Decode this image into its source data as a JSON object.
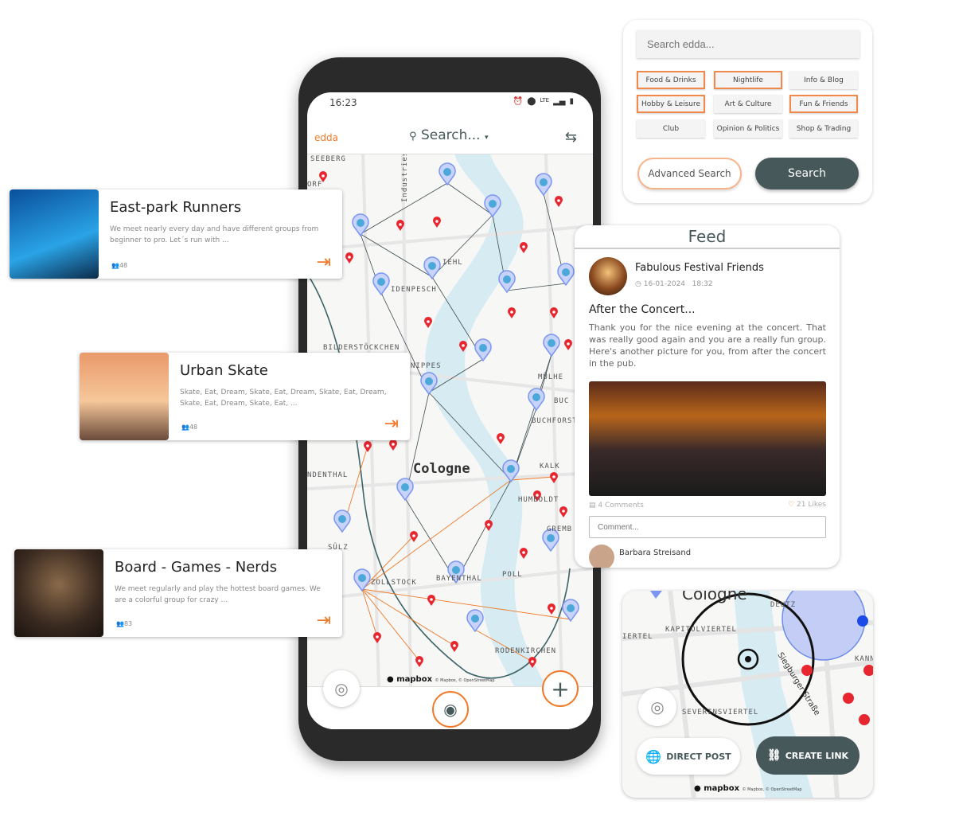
{
  "phone": {
    "status_time": "16:23",
    "status_network": "LTE",
    "app_logo": "edda",
    "header_search": "Search...",
    "map_labels": [
      "SEEBERG",
      "ORF",
      "Industriestraße",
      "IEHL",
      "IDENPESCH",
      "BILDERSTÖCKCHEN",
      "NIPPES",
      "MÜLHE",
      "BUC",
      "BUCHFORST",
      "Cologne",
      "KALK",
      "NDENTHAL",
      "HUMBOLDT",
      "GREMB",
      "SÜLZ",
      "ZOLLSTOCK",
      "BAYENTHAL",
      "POLL",
      "RODENKIRCHEN"
    ],
    "mapbox": "mapbox",
    "attribution": "© Mapbox, © OpenStreetMap",
    "icons": [
      "search-icon",
      "swap-icon",
      "locate-icon",
      "nearby-pin-icon",
      "plus-icon"
    ]
  },
  "groups": [
    {
      "title": "East-park Runners",
      "description": "We meet nearly every day and have different groups from beginner to pro. Let´s run with ...",
      "members": "48"
    },
    {
      "title": "Urban Skate",
      "description": "Skate, Eat, Dream, Skate, Eat, Dream, Skate, Eat, Dream, Skate, Eat, Dream, Skate, Eat, ...",
      "members": "48"
    },
    {
      "title": "Board - Games - Nerds",
      "description": "We meet regularly and play the hottest board games. We are a colorful group for crazy ...",
      "members": "83"
    }
  ],
  "search_panel": {
    "placeholder": "Search edda...",
    "categories": [
      {
        "label": "Food & Drinks",
        "selected": true
      },
      {
        "label": "Nightlife",
        "selected": true
      },
      {
        "label": "Info & Blog",
        "selected": false
      },
      {
        "label": "Hobby & Leisure",
        "selected": true
      },
      {
        "label": "Art & Culture",
        "selected": false
      },
      {
        "label": "Fun & Friends",
        "selected": true
      },
      {
        "label": "Club",
        "selected": false
      },
      {
        "label": "Opinion & Politics",
        "selected": false
      },
      {
        "label": "Shop & Trading",
        "selected": false
      }
    ],
    "advanced_label": "Advanced Search",
    "search_label": "Search"
  },
  "feed": {
    "title": "Feed",
    "post": {
      "group": "Fabulous Festival Friends",
      "date": "16-01-2024",
      "time": "18:32",
      "heading": "After the Concert...",
      "text": "Thank you for the nice evening at the concert. That was really good again and you are a really fun group. Here's another picture for you, from after the concert in the pub.",
      "comments": "4 Comments",
      "likes": "21 Likes",
      "comment_placeholder": "Comment...",
      "commenter": "Barbara Streisand"
    }
  },
  "map_card": {
    "labels": [
      "Cologne",
      "DEUTZ",
      "KAPITOLVIERTEL",
      "IERTEL",
      "Siegburger Straße",
      "SEVERINSVIERTEL",
      "KANN"
    ],
    "direct_post_label": "DIRECT POST",
    "create_link_label": "CREATE LINK",
    "mapbox": "mapbox",
    "attribution": "© Mapbox, © OpenStreetMap"
  },
  "colors": {
    "accent": "#f07a2a",
    "primary": "#47585a",
    "pin_blue": "#7b96f0",
    "pin_red": "#e8262f",
    "river": "#d6ebf2"
  }
}
